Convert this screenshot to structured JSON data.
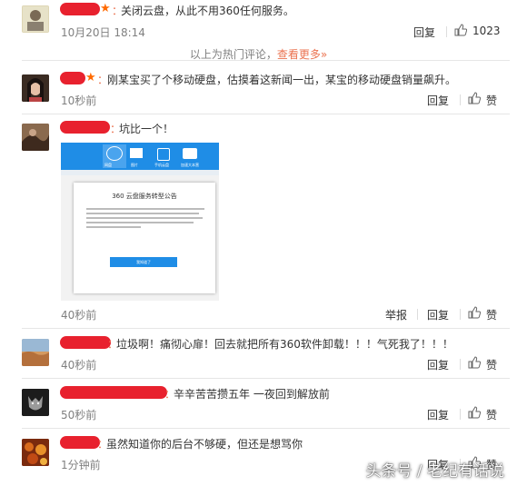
{
  "comments": [
    {
      "text": "关闭云盘，从此不用360任何服务。",
      "time": "10月20日 18:14",
      "reply": "回复",
      "like": "1023",
      "report": ""
    },
    {
      "text": "刚某宝买了个移动硬盘，估摸着这新闻一出，某宝的移动硬盘销量飙升。",
      "time": "10秒前",
      "reply": "回复",
      "like": "赞",
      "report": ""
    },
    {
      "text": "坑比一个！",
      "time": "40秒前",
      "reply": "回复",
      "like": "赞",
      "report": "举报"
    },
    {
      "text": "垃圾啊！痛彻心扉！回去就把所有360软件卸载！！！气死我了！！！",
      "time": "40秒前",
      "reply": "回复",
      "like": "赞",
      "report": ""
    },
    {
      "text": "辛辛苦苦攒五年 一夜回到解放前",
      "time": "50秒前",
      "reply": "回复",
      "like": "赞",
      "report": ""
    },
    {
      "text": "虽然知道你的后台不够硬，但还是想骂你",
      "time": "1分钟前",
      "reply": "回复",
      "like": "赞",
      "report": ""
    }
  ],
  "hot_notice": {
    "text": "以上为热门评论，",
    "link": "查看更多»"
  },
  "attachment": {
    "title": "360 云盘服务转型公告",
    "toolbar": [
      "网盘",
      "图片",
      "手机云盘",
      "加速大本营"
    ],
    "button": "我知道了"
  },
  "watermark": "头条号 / 老纪有话说",
  "colors": {
    "accent": "#eb7350",
    "username_redaction": "#e8212e",
    "text": "#333333",
    "meta": "#808080"
  }
}
